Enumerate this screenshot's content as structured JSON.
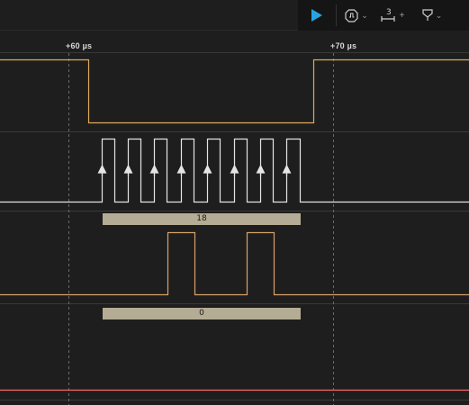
{
  "toolbar": {
    "play_icon": "play-icon",
    "trigger_icon": "trigger-icon",
    "measure_icon": "measure-icon",
    "measure_number": "3",
    "measure_plus": "+",
    "marker_icon": "marker-icon",
    "chevron": "⌄"
  },
  "timeline": {
    "ticks": [
      "+60 µs",
      "+70 µs"
    ]
  },
  "decoders": {
    "byte1": "18",
    "byte2": "0"
  },
  "colors": {
    "background": "#1e1e1e",
    "toolbar_dark": "#151515",
    "accent_play": "#29a3e0",
    "waveform_orange": "#e0a85a",
    "waveform_clock": "#e4e4e4",
    "waveform_data": "#d9a06a",
    "waveform_red": "#ff6a6a",
    "bus_fill": "#b4ac94"
  }
}
